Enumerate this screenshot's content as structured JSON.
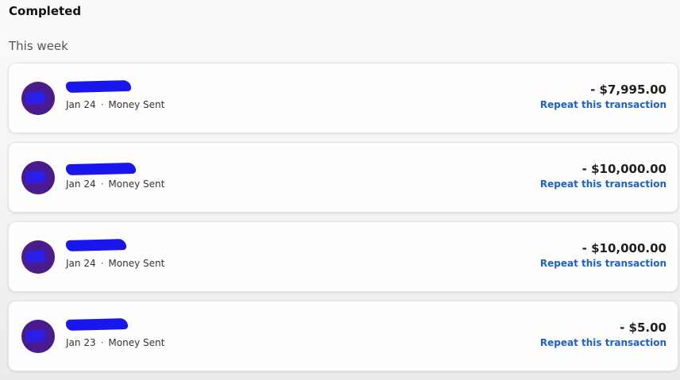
{
  "header": {
    "section_title": "Completed",
    "group_title": "This week"
  },
  "transactions": [
    {
      "date": "Jan 24",
      "separator": "·",
      "type": "Money Sent",
      "amount": "- $7,995.00",
      "action": "Repeat this transaction"
    },
    {
      "date": "Jan 24",
      "separator": "·",
      "type": "Money Sent",
      "amount": "- $10,000.00",
      "action": "Repeat this transaction"
    },
    {
      "date": "Jan 24",
      "separator": "·",
      "type": "Money Sent",
      "amount": "- $10,000.00",
      "action": "Repeat this transaction"
    },
    {
      "date": "Jan 23",
      "separator": "·",
      "type": "Money Sent",
      "amount": "- $5.00",
      "action": "Repeat this transaction"
    }
  ],
  "colors": {
    "avatar": "#4a1b8c",
    "redaction": "#1a17ee",
    "link": "#1d5fd3"
  }
}
